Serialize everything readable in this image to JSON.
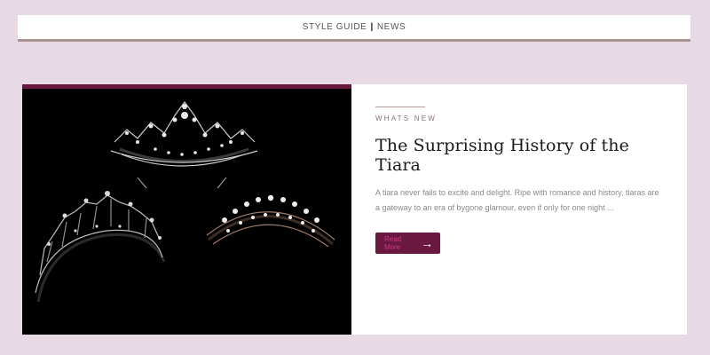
{
  "nav": {
    "items": [
      {
        "label": "STYLE GUIDE"
      },
      {
        "label": "NEWS"
      }
    ],
    "separator": "|"
  },
  "article": {
    "category": "WHATS NEW",
    "title": "The Surprising History of the Tiara",
    "excerpt": "A tiara never fails to excite and delight. Ripe with romance and history, tiaras are a gateway to an era of bygone glamour, even if only for one night ...",
    "button_label": "Read More",
    "button_icon": "arrow-right-icon"
  },
  "colors": {
    "page_bg": "#e8dae5",
    "accent": "#6b1840",
    "nav_border": "#a8938f"
  }
}
